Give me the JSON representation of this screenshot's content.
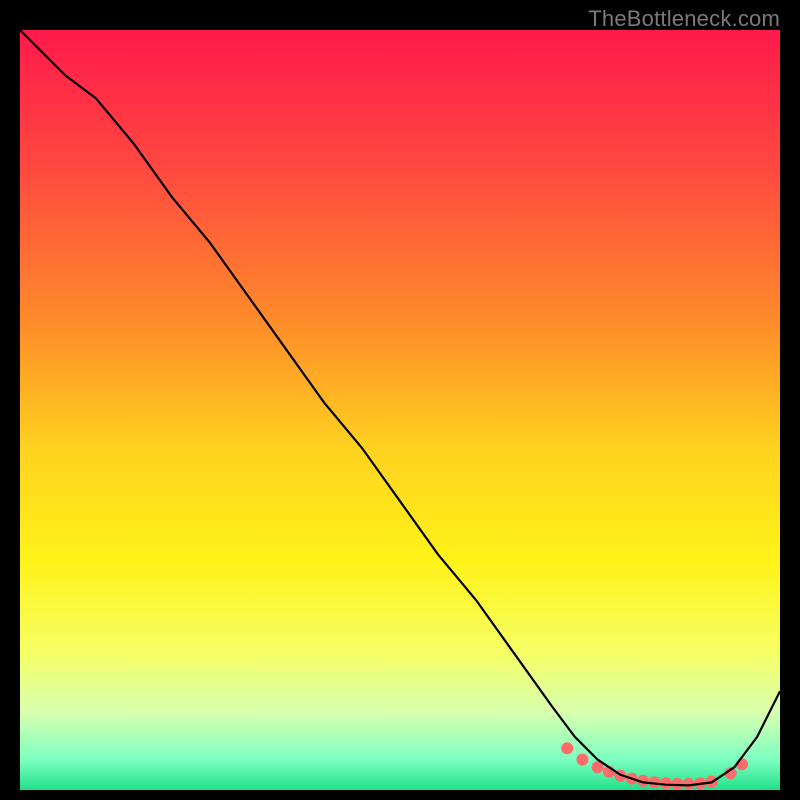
{
  "watermark": "TheBottleneck.com",
  "chart_data": {
    "type": "line",
    "title": "",
    "xlabel": "",
    "ylabel": "",
    "xlim": [
      0,
      100
    ],
    "ylim": [
      0,
      100
    ],
    "grid": false,
    "legend": false,
    "gradient_stops": [
      {
        "offset": 0,
        "color": "#ff1a4b"
      },
      {
        "offset": 18,
        "color": "#ff4840"
      },
      {
        "offset": 38,
        "color": "#ff8a2a"
      },
      {
        "offset": 55,
        "color": "#ffd21f"
      },
      {
        "offset": 70,
        "color": "#fff31a"
      },
      {
        "offset": 82,
        "color": "#f6ff66"
      },
      {
        "offset": 90,
        "color": "#d6ffb0"
      },
      {
        "offset": 96,
        "color": "#7dffc1"
      },
      {
        "offset": 100,
        "color": "#21e08a"
      }
    ],
    "series": [
      {
        "name": "curve",
        "color": "#000000",
        "x": [
          0,
          3,
          6,
          10,
          15,
          20,
          25,
          30,
          35,
          40,
          45,
          50,
          55,
          60,
          65,
          70,
          73,
          76,
          79,
          82,
          85,
          88,
          91,
          94,
          97,
          100
        ],
        "y": [
          100,
          97,
          94,
          91,
          85,
          78,
          72,
          65,
          58,
          51,
          45,
          38,
          31,
          25,
          18,
          11,
          7,
          4,
          2,
          1,
          0.7,
          0.6,
          1,
          3,
          7,
          13
        ]
      }
    ],
    "markers": {
      "name": "highlight-dots",
      "color": "#ff6a6a",
      "radius": 6,
      "x": [
        72,
        74,
        76,
        77.5,
        79,
        80.5,
        82,
        83.5,
        85,
        86.5,
        88,
        89.5,
        91,
        93.5,
        95
      ],
      "y": [
        5.5,
        4,
        3,
        2.4,
        1.9,
        1.5,
        1.2,
        1.0,
        0.9,
        0.8,
        0.8,
        0.9,
        1.1,
        2.2,
        3.4
      ]
    }
  }
}
